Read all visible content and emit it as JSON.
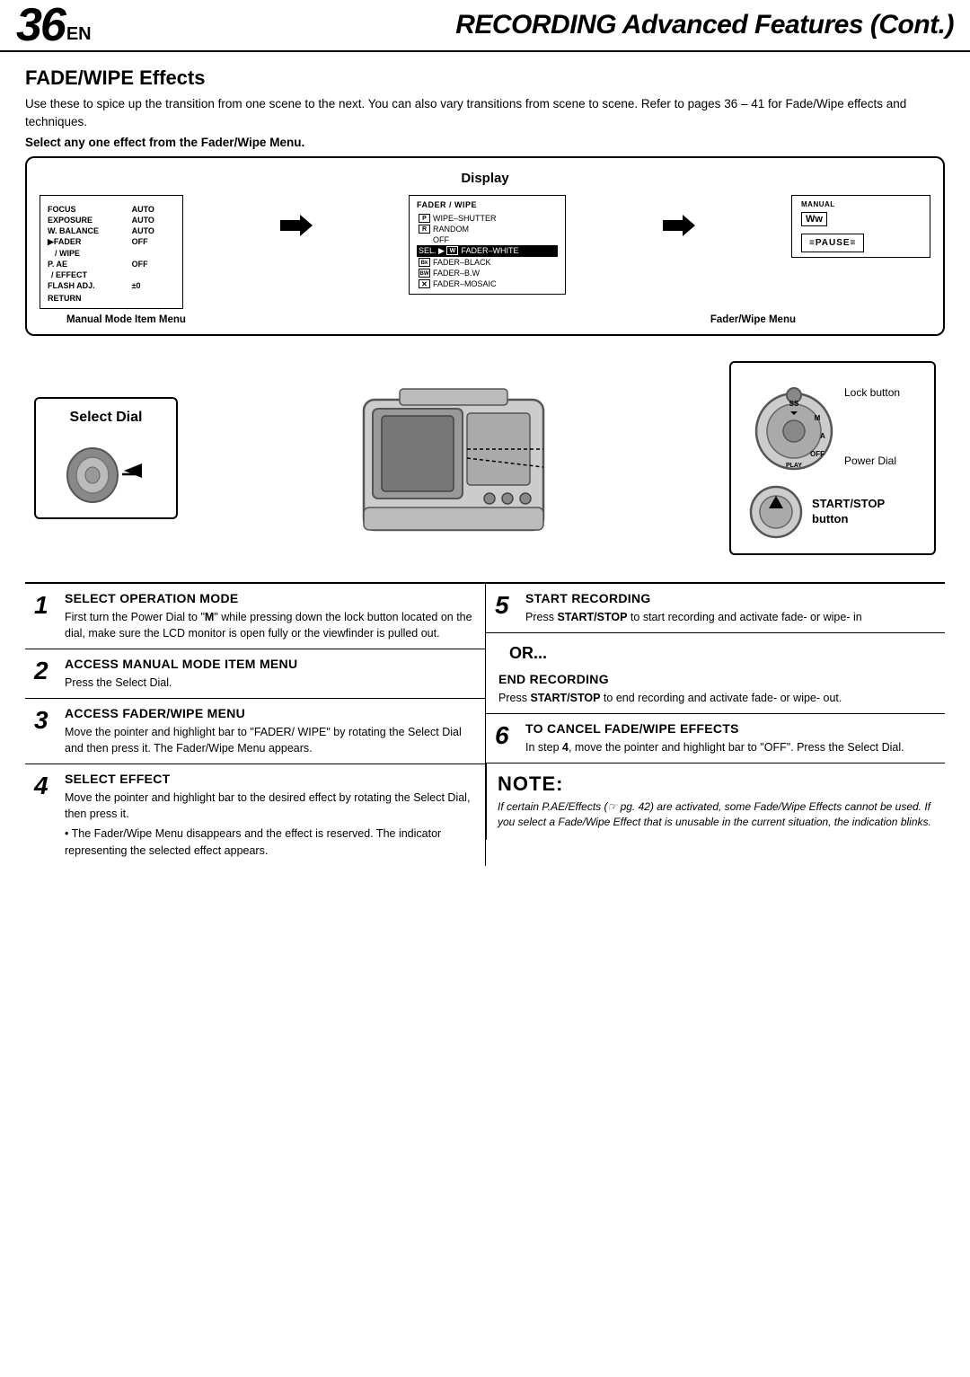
{
  "header": {
    "page_num": "36",
    "lang": "EN",
    "title": "RECORDING Advanced Features (Cont.)"
  },
  "section": {
    "title": "FADE/WIPE Effects",
    "intro": "Use these to spice up the transition from one scene to the next. You can also vary transitions from scene to scene. Refer to pages 36 – 41 for Fade/Wipe effects and techniques.",
    "instruction": "Select any one effect from the Fader/Wipe Menu."
  },
  "display": {
    "label": "Display",
    "manual_mode_menu": {
      "title": "Manual Mode Item Menu",
      "items": [
        {
          "label": "FOCUS",
          "value": "AUTO"
        },
        {
          "label": "EXPOSURE",
          "value": "AUTO"
        },
        {
          "label": "W. BALANCE",
          "value": "AUTO"
        },
        {
          "label": "▶FADER",
          "value": "OFF",
          "pointer": true,
          "bold": true
        },
        {
          "label": "  / WIPE",
          "value": "",
          "bold": true
        },
        {
          "label": "P. AE",
          "value": "OFF"
        },
        {
          "label": "  / EFFECT",
          "value": ""
        },
        {
          "label": "FLASH ADJ.",
          "value": "±0"
        },
        {
          "label": "RETURN",
          "value": ""
        }
      ]
    },
    "fader_wipe_menu": {
      "title": "FADER / WIPE",
      "label": "Fader/Wipe Menu",
      "items": [
        {
          "icon": "P",
          "label": "WIPE–SHUTTER"
        },
        {
          "icon": "R",
          "label": "RANDOM"
        },
        {
          "label": "OFF"
        },
        {
          "label": "SEL. ▶",
          "icon": "W",
          "item_label": "FADER–WHITE",
          "selected": true
        },
        {
          "icon": "Bk",
          "label": "FADER–BLACK"
        },
        {
          "icon": "BW",
          "label": "FADER–B.W"
        },
        {
          "icon": "X",
          "label": "FADER–MOSAIC"
        }
      ]
    },
    "manual_box": {
      "title": "MANUAL",
      "ww_label": "Ww",
      "pause_label": "≡PAUSE≡"
    }
  },
  "select_dial": {
    "label": "Select Dial"
  },
  "controls": {
    "lock_button": "Lock button",
    "power_dial": "Power Dial",
    "start_stop": "START/STOP\nbutton"
  },
  "steps": [
    {
      "num": "1",
      "title": "SELECT OPERATION MODE",
      "body": "First turn the Power Dial to \"M\" while pressing down the lock button located on the dial, make sure the LCD monitor is open fully or the viewfinder is pulled out."
    },
    {
      "num": "2",
      "title": "ACCESS MANUAL MODE ITEM MENU",
      "body": "Press the Select Dial."
    },
    {
      "num": "3",
      "title": "ACCESS FADER/WIPE MENU",
      "body": "Move the pointer and highlight bar to \"FADER/WIPE\" by rotating the Select Dial and then press it. The Fader/Wipe Menu appears."
    },
    {
      "num": "4",
      "title": "SELECT EFFECT",
      "body": "Move the pointer and highlight bar to the desired effect by rotating the Select Dial, then press it.",
      "bullet": "The Fader/Wipe Menu disappears and the effect is reserved. The indicator representing the selected effect appears."
    },
    {
      "num": "5",
      "title": "START RECORDING",
      "body": "Press START/STOP to start recording and activate fade- or wipe- in",
      "bold_word": "START/STOP"
    },
    {
      "num": "6",
      "title": "TO CANCEL FADE/WIPE EFFECTS",
      "body": "In step 4, move the pointer and highlight bar to \"OFF\". Press the Select Dial."
    }
  ],
  "or_label": "OR...",
  "end_recording": {
    "title": "END RECORDING",
    "body": "Press START/STOP to end recording and activate fade- or wipe- out.",
    "bold_word": "START/STOP"
  },
  "note": {
    "title": "NOTE:",
    "body": "If certain P.AE/Effects (☞ pg. 42) are activated, some Fade/Wipe Effects cannot be used. If you select a Fade/Wipe Effect that is unusable in the current situation, the indication blinks."
  }
}
